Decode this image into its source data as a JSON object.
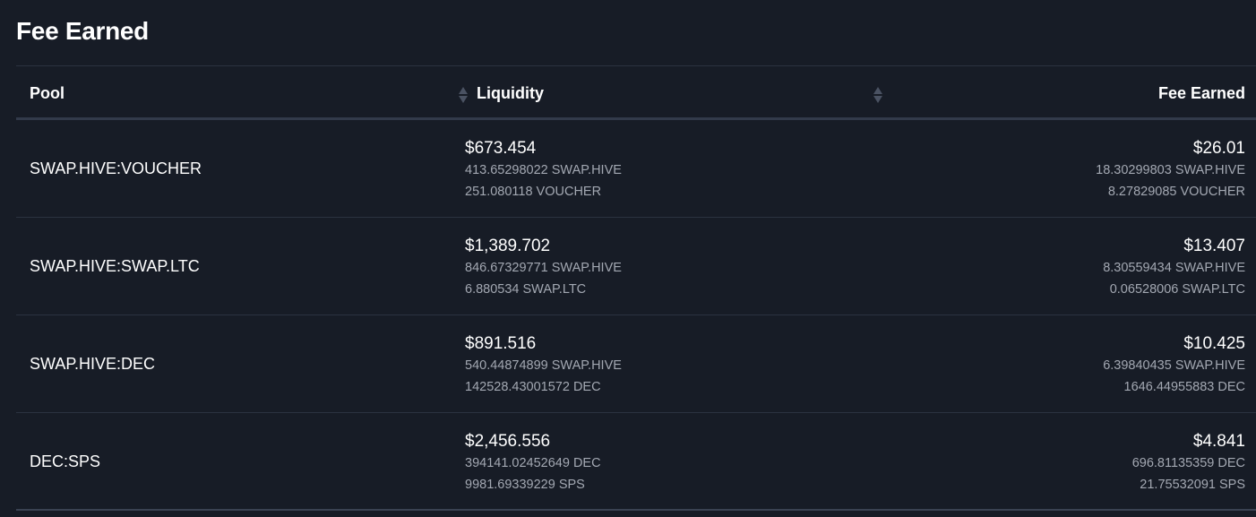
{
  "section": {
    "title": "Fee Earned"
  },
  "table": {
    "headers": {
      "pool": "Pool",
      "liquidity": "Liquidity",
      "fee": "Fee Earned"
    },
    "rows": [
      {
        "pool": "SWAP.HIVE:VOUCHER",
        "liquidity_usd": "$673.454",
        "liquidity_amount_1": "413.65298022 SWAP.HIVE",
        "liquidity_amount_2": "251.080118 VOUCHER",
        "fee_usd": "$26.01",
        "fee_amount_1": "18.30299803 SWAP.HIVE",
        "fee_amount_2": "8.27829085 VOUCHER"
      },
      {
        "pool": "SWAP.HIVE:SWAP.LTC",
        "liquidity_usd": "$1,389.702",
        "liquidity_amount_1": "846.67329771 SWAP.HIVE",
        "liquidity_amount_2": "6.880534 SWAP.LTC",
        "fee_usd": "$13.407",
        "fee_amount_1": "8.30559434 SWAP.HIVE",
        "fee_amount_2": "0.06528006 SWAP.LTC"
      },
      {
        "pool": "SWAP.HIVE:DEC",
        "liquidity_usd": "$891.516",
        "liquidity_amount_1": "540.44874899 SWAP.HIVE",
        "liquidity_amount_2": "142528.43001572 DEC",
        "fee_usd": "$10.425",
        "fee_amount_1": "6.39840435 SWAP.HIVE",
        "fee_amount_2": "1646.44955883 DEC"
      },
      {
        "pool": "DEC:SPS",
        "liquidity_usd": "$2,456.556",
        "liquidity_amount_1": "394141.02452649 DEC",
        "liquidity_amount_2": "9981.69339229 SPS",
        "fee_usd": "$4.841",
        "fee_amount_1": "696.81135359 DEC",
        "fee_amount_2": "21.75532091 SPS"
      }
    ]
  },
  "icons": {
    "sort": "sort-arrows-icon"
  },
  "colors": {
    "background": "#171c26",
    "text_primary": "#ffffff",
    "text_secondary": "#a3a8b2",
    "divider": "#2b3240",
    "sort_icon": "#4a5262"
  }
}
